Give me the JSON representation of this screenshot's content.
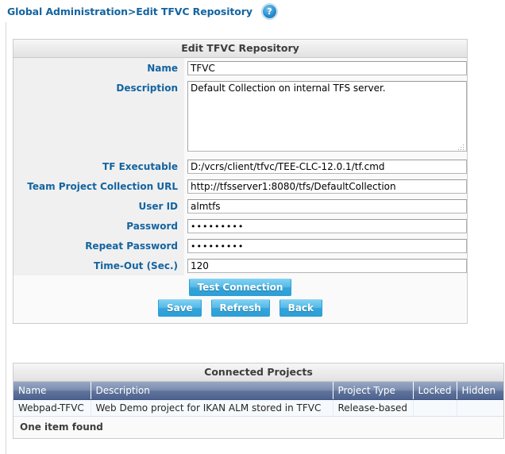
{
  "breadcrumb": {
    "text": "Global Administration>Edit TFVC Repository",
    "help_icon": "help-question-icon",
    "help_glyph": "?"
  },
  "form_panel": {
    "title": "Edit TFVC Repository",
    "fields": [
      {
        "label": "Name",
        "value": "TFVC",
        "type": "text"
      },
      {
        "label": "Description",
        "value": "Default Collection on internal TFS server.",
        "type": "textarea"
      },
      {
        "label": "TF Executable",
        "value": "D:/vcrs/client/tfvc/TEE-CLC-12.0.1/tf.cmd",
        "type": "text"
      },
      {
        "label": "Team Project Collection URL",
        "value": "http://tfsserver1:8080/tfs/DefaultCollection",
        "type": "text"
      },
      {
        "label": "User ID",
        "value": "almtfs",
        "type": "text"
      },
      {
        "label": "Password",
        "value": "•••••••••",
        "type": "password"
      },
      {
        "label": "Repeat Password",
        "value": "•••••••••",
        "type": "password"
      },
      {
        "label": "Time-Out (Sec.)",
        "value": "120",
        "type": "text"
      }
    ],
    "buttons_primary": [
      {
        "label": "Test Connection",
        "name": "test-connection-button"
      }
    ],
    "buttons_secondary": [
      {
        "label": "Save",
        "name": "save-button"
      },
      {
        "label": "Refresh",
        "name": "refresh-button"
      },
      {
        "label": "Back",
        "name": "back-button"
      }
    ]
  },
  "projects_panel": {
    "title": "Connected Projects",
    "columns": [
      "Name",
      "Description",
      "Project Type",
      "Locked",
      "Hidden"
    ],
    "rows": [
      {
        "name": "Webpad-TFVC",
        "description": "Web Demo project for IKAN ALM stored in TFVC",
        "project_type": "Release-based",
        "locked": "",
        "hidden": ""
      }
    ],
    "footer": "One item found"
  },
  "colors": {
    "label_blue": "#1464a0",
    "button_blue": "#34a5db",
    "grid_header": "#62769c",
    "panel_header": "#ececec"
  }
}
